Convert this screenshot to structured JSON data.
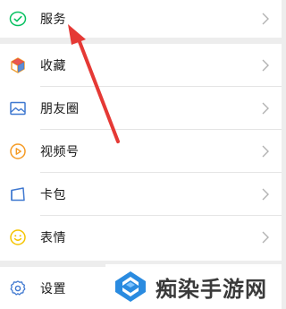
{
  "menu": {
    "services": {
      "label": "服务",
      "icon": "services-check-icon"
    },
    "items": [
      {
        "label": "收藏",
        "icon": "favorites-cube-icon"
      },
      {
        "label": "朋友圈",
        "icon": "moments-picture-icon"
      },
      {
        "label": "视频号",
        "icon": "channels-play-icon"
      },
      {
        "label": "卡包",
        "icon": "card-wallet-icon"
      },
      {
        "label": "表情",
        "icon": "sticker-smiley-icon"
      }
    ],
    "settings": {
      "label": "设置",
      "icon": "settings-gear-icon"
    }
  },
  "watermark": {
    "text": "痴染手游网"
  },
  "colors": {
    "background": "#ededed",
    "row": "#ffffff",
    "text": "#191919",
    "chevron": "#b2b2b2",
    "arrow": "#e53935",
    "services_icon": "#07c160",
    "favorites_icon": "#f0a33a",
    "moments_icon": "#3f78d0",
    "channels_icon": "#f59a23",
    "card_icon": "#3f78d0",
    "sticker_icon": "#f5c400",
    "settings_icon": "#3f78d0"
  }
}
